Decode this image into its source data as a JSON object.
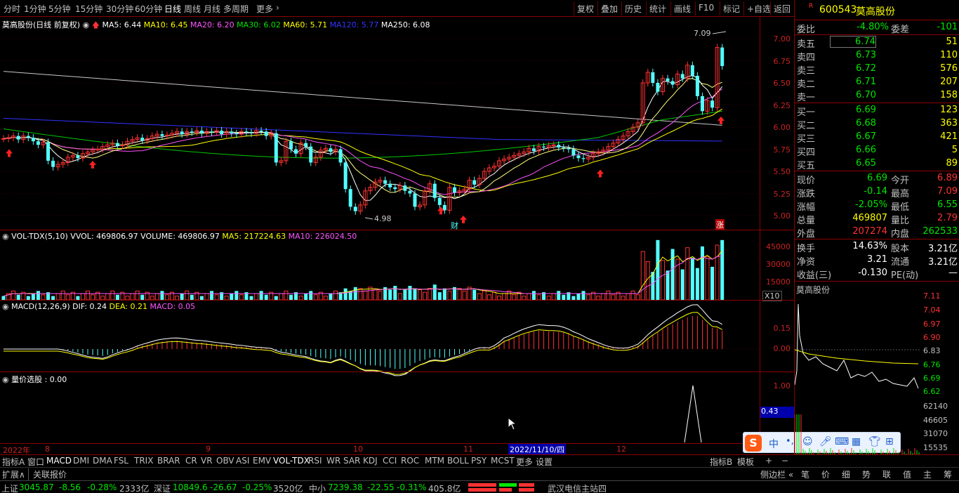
{
  "toolbar": {
    "periods": [
      "分时",
      "1分钟",
      "5分钟",
      "15分钟",
      "30分钟",
      "60分钟",
      "日线",
      "周线",
      "月线",
      "多周期",
      "更多"
    ],
    "right": [
      "复权",
      "叠加",
      "历史",
      "统计",
      "画线",
      "F10",
      "标记",
      "+自选",
      "返回"
    ]
  },
  "kline": {
    "title": "莫高股份(日线 前复权)",
    "ma": [
      {
        "label": "MA5: 6.44",
        "color": "#ffffff"
      },
      {
        "label": "MA10: 6.45",
        "color": "#ffff00"
      },
      {
        "label": "MA20: 6.20",
        "color": "#ff54ff"
      },
      {
        "label": "MA30: 6.02",
        "color": "#00e600"
      },
      {
        "label": "MA60: 5.71",
        "color": "#ffff00"
      },
      {
        "label": "MA120: 5.77",
        "color": "#3232ff"
      },
      {
        "label": "MA250: 6.08",
        "color": "#ffffff"
      }
    ],
    "y_ticks": [
      "7.00",
      "6.75",
      "6.50",
      "6.25",
      "6.00",
      "5.75",
      "5.50",
      "5.25",
      "5.00"
    ],
    "high_label": "7.09",
    "low_label": "4.98",
    "cai_label": "财",
    "zhang_label": "涨"
  },
  "vol": {
    "title": "VOL-TDX(5,10)",
    "vvol": "VVOL: 469806.97",
    "volume": "VOLUME: 469806.97",
    "ma5": "MA5: 217224.63",
    "ma10": "MA10: 226024.50",
    "y_ticks": [
      "45000",
      "30000",
      "15000"
    ],
    "unit": "X10"
  },
  "macd": {
    "title": "MACD(12,26,9)",
    "dif": "DIF: 0.24",
    "dea": "DEA: 0.21",
    "macd": "MACD: 0.05",
    "y_ticks": [
      "0.15",
      "0.00"
    ]
  },
  "lj": {
    "title": "量价选股",
    "value": ": 0.00",
    "y_tick": "1.00",
    "cursor_value": "0.43"
  },
  "xaxis": {
    "labels": [
      "2022年",
      "8",
      "9",
      "10",
      "11",
      "12"
    ],
    "cursor_date": "2022/11/10/四"
  },
  "quote": {
    "code": "600543",
    "name": "莫高股份",
    "weibi_label": "委比",
    "weibi": "-4.80%",
    "weicha_label": "委差",
    "weicha": "-101",
    "sell": [
      {
        "label": "卖五",
        "price": "6.74",
        "vol": "51"
      },
      {
        "label": "卖四",
        "price": "6.73",
        "vol": "110"
      },
      {
        "label": "卖三",
        "price": "6.72",
        "vol": "576"
      },
      {
        "label": "卖二",
        "price": "6.71",
        "vol": "207"
      },
      {
        "label": "卖一",
        "price": "6.70",
        "vol": "158"
      }
    ],
    "buy": [
      {
        "label": "买一",
        "price": "6.69",
        "vol": "123"
      },
      {
        "label": "买二",
        "price": "6.68",
        "vol": "363"
      },
      {
        "label": "买三",
        "price": "6.67",
        "vol": "421"
      },
      {
        "label": "买四",
        "price": "6.66",
        "vol": "5"
      },
      {
        "label": "买五",
        "price": "6.65",
        "vol": "89"
      }
    ],
    "stats": [
      {
        "l1": "现价",
        "v1": "6.69",
        "l2": "今开",
        "v2": "6.89"
      },
      {
        "l1": "涨跌",
        "v1": "-0.14",
        "l2": "最高",
        "v2": "7.09"
      },
      {
        "l1": "涨幅",
        "v1": "-2.05%",
        "l2": "最低",
        "v2": "6.55"
      },
      {
        "l1": "总量",
        "v1": "469807",
        "l2": "量比",
        "v2": "2.79"
      },
      {
        "l1": "外盘",
        "v1": "207274",
        "l2": "内盘",
        "v2": "262533"
      }
    ],
    "fund": [
      {
        "l1": "换手",
        "v1": "14.63%",
        "l2": "股本",
        "v2": "3.21亿"
      },
      {
        "l1": "净资",
        "v1": "3.21",
        "l2": "流通",
        "v2": "3.21亿"
      },
      {
        "l1": "收益(三)",
        "v1": "-0.130",
        "l2": "PE(动)",
        "v2": "—"
      }
    ],
    "mini_title": "莫高股份",
    "mini_ticks": [
      "7.11",
      "7.04",
      "6.97",
      "6.90",
      "6.83",
      "6.76",
      "6.69",
      "6.62"
    ],
    "mini_vol_ticks": [
      "62140",
      "46605",
      "31070",
      "15535"
    ]
  },
  "bottom_tabs": {
    "left": [
      "指标A",
      "窗口",
      "MACD",
      "DMI",
      "DMA",
      "FSL",
      "TRIX",
      "BRAR",
      "CR",
      "VR",
      "OBV",
      "ASI",
      "EMV",
      "VOL-TDX",
      "RSI",
      "WR",
      "SAR",
      "KDJ",
      "CCI",
      "ROC",
      "MTM",
      "BOLL",
      "PSY",
      "MCST",
      "更多",
      "设置"
    ],
    "right": [
      "指标B",
      "模板"
    ],
    "row2": [
      "扩展∧",
      "关联报价"
    ],
    "sidebar": "侧边栏 «",
    "sidebar_items": [
      "笔",
      "价",
      "细",
      "势",
      "联",
      "值",
      "主",
      "筹"
    ]
  },
  "status": {
    "sh_label": "上证",
    "sh": "3045.87",
    "sh_chg": "-8.56",
    "sh_pct": "-0.28%",
    "sh_amt": "2333亿",
    "sz_label": "深证",
    "sz": "10849.6",
    "sz_chg": "-26.67",
    "sz_pct": "-0.25%",
    "sz_amt": "3520亿",
    "zx_label": "中小",
    "zx": "7239.38",
    "zx_chg": "-22.55",
    "zx_pct": "-0.31%",
    "zx_amt": "405.8亿",
    "server": "武汉电信主站四"
  },
  "ime": {
    "label": "中"
  }
}
